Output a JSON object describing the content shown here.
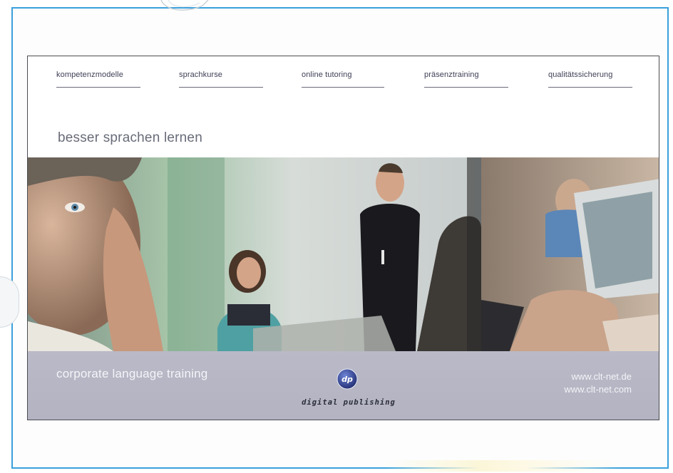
{
  "nav": {
    "items": [
      {
        "label": "kompetenzmodelle"
      },
      {
        "label": "sprachkurse"
      },
      {
        "label": "online tutoring"
      },
      {
        "label": "präsenztraining"
      },
      {
        "label": "qualitätssicherung"
      }
    ]
  },
  "hero": {
    "tagline": "besser sprachen lernen"
  },
  "footer": {
    "title": "corporate language training",
    "logo_mark": "dp",
    "logo_text": "digital publishing",
    "urls": [
      "www.clt-net.de",
      "www.clt-net.com"
    ]
  },
  "colors": {
    "frame": "#3aa0dc",
    "bar": "#b6b6c4",
    "logo": "#2f3a8c"
  }
}
